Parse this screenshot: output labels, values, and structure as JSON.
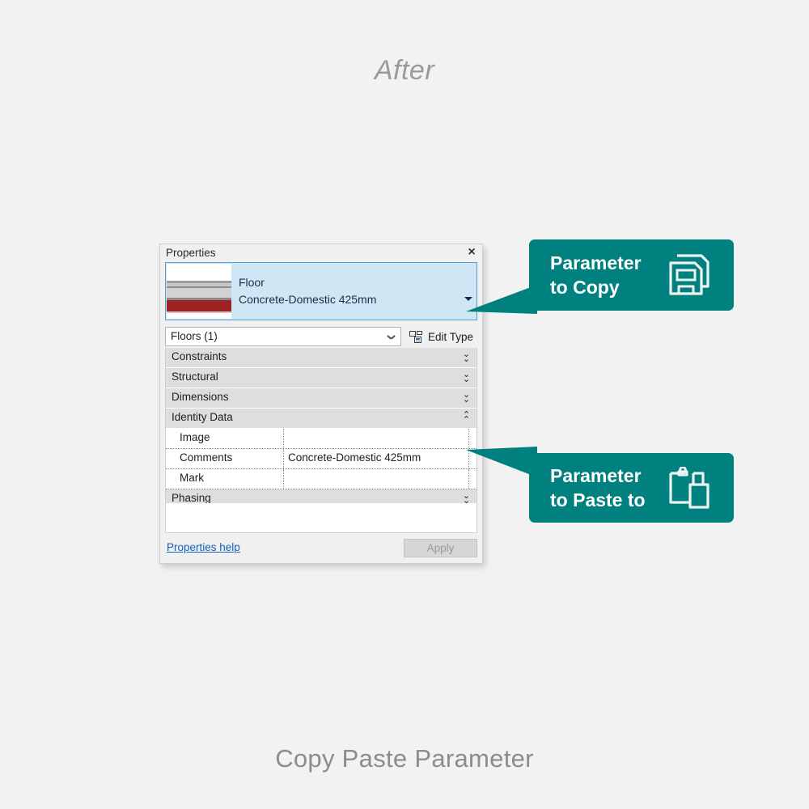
{
  "page": {
    "heading": "After",
    "caption": "Copy Paste Parameter",
    "accent_color": "#00807f",
    "background_color": "#f2f2f2"
  },
  "panel": {
    "title": "Properties",
    "close_icon": "×",
    "type_selector": {
      "family": "Floor",
      "type_name": "Concrete-Domestic 425mm",
      "dropdown_icon": "caret-down-icon",
      "thumbnail_icon": "floor-assembly-thumbnail"
    },
    "instance_selector": {
      "value": "Floors (1)",
      "dropdown_icon": "chevron-down-icon"
    },
    "edit_type": {
      "label": "Edit Type",
      "icon": "edit-type-icon"
    },
    "groups": [
      {
        "label": "Constraints",
        "state": "collapsed",
        "chevron": "double-chevron-down-icon"
      },
      {
        "label": "Structural",
        "state": "collapsed",
        "chevron": "double-chevron-down-icon"
      },
      {
        "label": "Dimensions",
        "state": "collapsed",
        "chevron": "double-chevron-down-icon"
      },
      {
        "label": "Identity Data",
        "state": "expanded",
        "chevron": "double-chevron-up-icon"
      }
    ],
    "parameters": [
      {
        "name": "Image",
        "value": ""
      },
      {
        "name": "Comments",
        "value": "Concrete-Domestic 425mm"
      },
      {
        "name": "Mark",
        "value": ""
      }
    ],
    "phasing_group": {
      "label": "Phasing",
      "state": "collapsed",
      "chevron": "double-chevron-down-icon"
    },
    "footer": {
      "help_link": "Properties help",
      "apply_button": "Apply"
    }
  },
  "callouts": [
    {
      "id": "copy",
      "text": "Parameter\nto Copy",
      "icon": "copy-save-icon"
    },
    {
      "id": "paste",
      "text": "Parameter\nto Paste to",
      "icon": "clipboard-paste-icon"
    }
  ]
}
